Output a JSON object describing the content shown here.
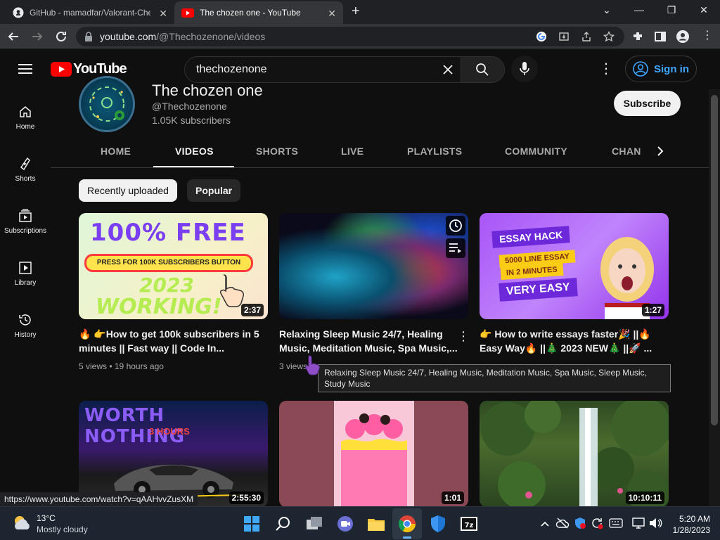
{
  "browser": {
    "tabs": [
      {
        "title": "GitHub - mamadfar/Valorant-Che",
        "close": "✕"
      },
      {
        "title": "The chozen one - YouTube",
        "close": "✕"
      }
    ],
    "new_tab": "+",
    "window_controls": {
      "dropdown": "⌄",
      "minimize": "—",
      "restore": "❐",
      "close": "✕"
    },
    "url_host": "youtube.com",
    "url_path": "/@Thechozenone/videos"
  },
  "youtube": {
    "logo_text": "YouTube",
    "search": {
      "value": "thechozenone",
      "placeholder": "Search"
    },
    "sign_in": "Sign in"
  },
  "sidebar": {
    "items": [
      {
        "label": "Home"
      },
      {
        "label": "Shorts"
      },
      {
        "label": "Subscriptions"
      },
      {
        "label": "Library"
      },
      {
        "label": "History"
      }
    ]
  },
  "channel": {
    "name": "The chozen one",
    "handle": "@Thechozenone",
    "subscribers": "1.05K subscribers",
    "subscribe_label": "Subscribe",
    "tabs": [
      "HOME",
      "VIDEOS",
      "SHORTS",
      "LIVE",
      "PLAYLISTS",
      "COMMUNITY",
      "CHANI"
    ],
    "active_tab": "VIDEOS"
  },
  "filters": {
    "chips": [
      "Recently uploaded",
      "Popular"
    ],
    "active": "Recently uploaded"
  },
  "videos": [
    {
      "title": "🔥 👉How to get 100k subscribers in 5 minutes || Fast way || Code In...",
      "meta": "5 views • 19 hours ago",
      "duration": "2:37",
      "thumb_text": {
        "line1": "100% FREE",
        "banner": "PRESS FOR 100K SUBSCRIBERS BUTTON",
        "line2": "2023",
        "line3": "WORKING!"
      }
    },
    {
      "title": "Relaxing Sleep Music 24/7, Healing Music, Meditation Music, Spa Music,...",
      "meta": "3 views",
      "duration": ""
    },
    {
      "title": "👉 How to write essays faster🎉 ||🔥 Easy Way🔥 ||🎄 2023 NEW🎄 ||🚀 ...",
      "meta": "",
      "duration": "1:27",
      "thumb_text": {
        "line1": "ESSAY HACK",
        "line2": "5000 LINE ESSAY",
        "line3": "IN 2 MINUTES",
        "line4": "VERY EASY"
      }
    },
    {
      "title": "",
      "meta": "",
      "duration": "2:55:30",
      "thumb_text": {
        "line1": "WORTH NOTHING",
        "line2": "3 HOURS"
      }
    },
    {
      "title": "",
      "meta": "",
      "duration": "1:01"
    },
    {
      "title": "",
      "meta": "",
      "duration": "10:10:11"
    }
  ],
  "tooltip": "Relaxing Sleep Music 24/7, Healing Music, Meditation Music, Spa Music, Sleep Music, Study Music",
  "status_url": "https://www.youtube.com/watch?v=qAAHvvZusXM",
  "taskbar": {
    "weather_temp": "13°C",
    "weather_desc": "Mostly cloudy",
    "time": "5:20 AM",
    "date": "1/28/2023"
  },
  "colors": {
    "accent": "#3ea6ff",
    "yt_red": "#ff0000",
    "background": "#0f0f0f"
  }
}
